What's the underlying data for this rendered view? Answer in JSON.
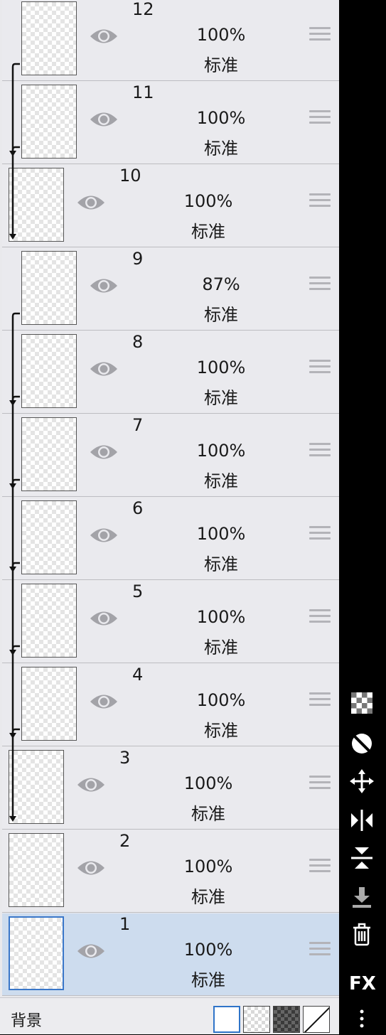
{
  "layers": [
    {
      "number": "12",
      "opacity": "100%",
      "blend": "标准",
      "clipped": true,
      "selected": false
    },
    {
      "number": "11",
      "opacity": "100%",
      "blend": "标准",
      "clipped": true,
      "selected": false
    },
    {
      "number": "10",
      "opacity": "100%",
      "blend": "标准",
      "clipped": false,
      "selected": false
    },
    {
      "number": "9",
      "opacity": "87%",
      "blend": "标准",
      "clipped": true,
      "selected": false
    },
    {
      "number": "8",
      "opacity": "100%",
      "blend": "标准",
      "clipped": true,
      "selected": false
    },
    {
      "number": "7",
      "opacity": "100%",
      "blend": "标准",
      "clipped": true,
      "selected": false
    },
    {
      "number": "6",
      "opacity": "100%",
      "blend": "标准",
      "clipped": true,
      "selected": false
    },
    {
      "number": "5",
      "opacity": "100%",
      "blend": "标准",
      "clipped": true,
      "selected": false
    },
    {
      "number": "4",
      "opacity": "100%",
      "blend": "标准",
      "clipped": true,
      "selected": false
    },
    {
      "number": "3",
      "opacity": "100%",
      "blend": "标准",
      "clipped": false,
      "selected": false
    },
    {
      "number": "2",
      "opacity": "100%",
      "blend": "标准",
      "clipped": false,
      "selected": false
    },
    {
      "number": "1",
      "opacity": "100%",
      "blend": "标准",
      "clipped": false,
      "selected": true
    }
  ],
  "background": {
    "label": "背景",
    "options": [
      "white",
      "transparent-checker",
      "dark-checker",
      "none"
    ],
    "selected": "white"
  },
  "toolbar": {
    "tools": [
      "transparency-lock-icon",
      "clipping-icon",
      "move-icon",
      "flip-horizontal-icon",
      "flip-vertical-icon",
      "merge-down-icon",
      "delete-icon",
      "fx-button",
      "more-icon"
    ],
    "fx_label": "FX"
  },
  "colors": {
    "panel_bg": "#eaeaee",
    "selected_row": "#cddcee",
    "selected_border": "#3a77c9",
    "toolbar_bg": "#000000"
  }
}
